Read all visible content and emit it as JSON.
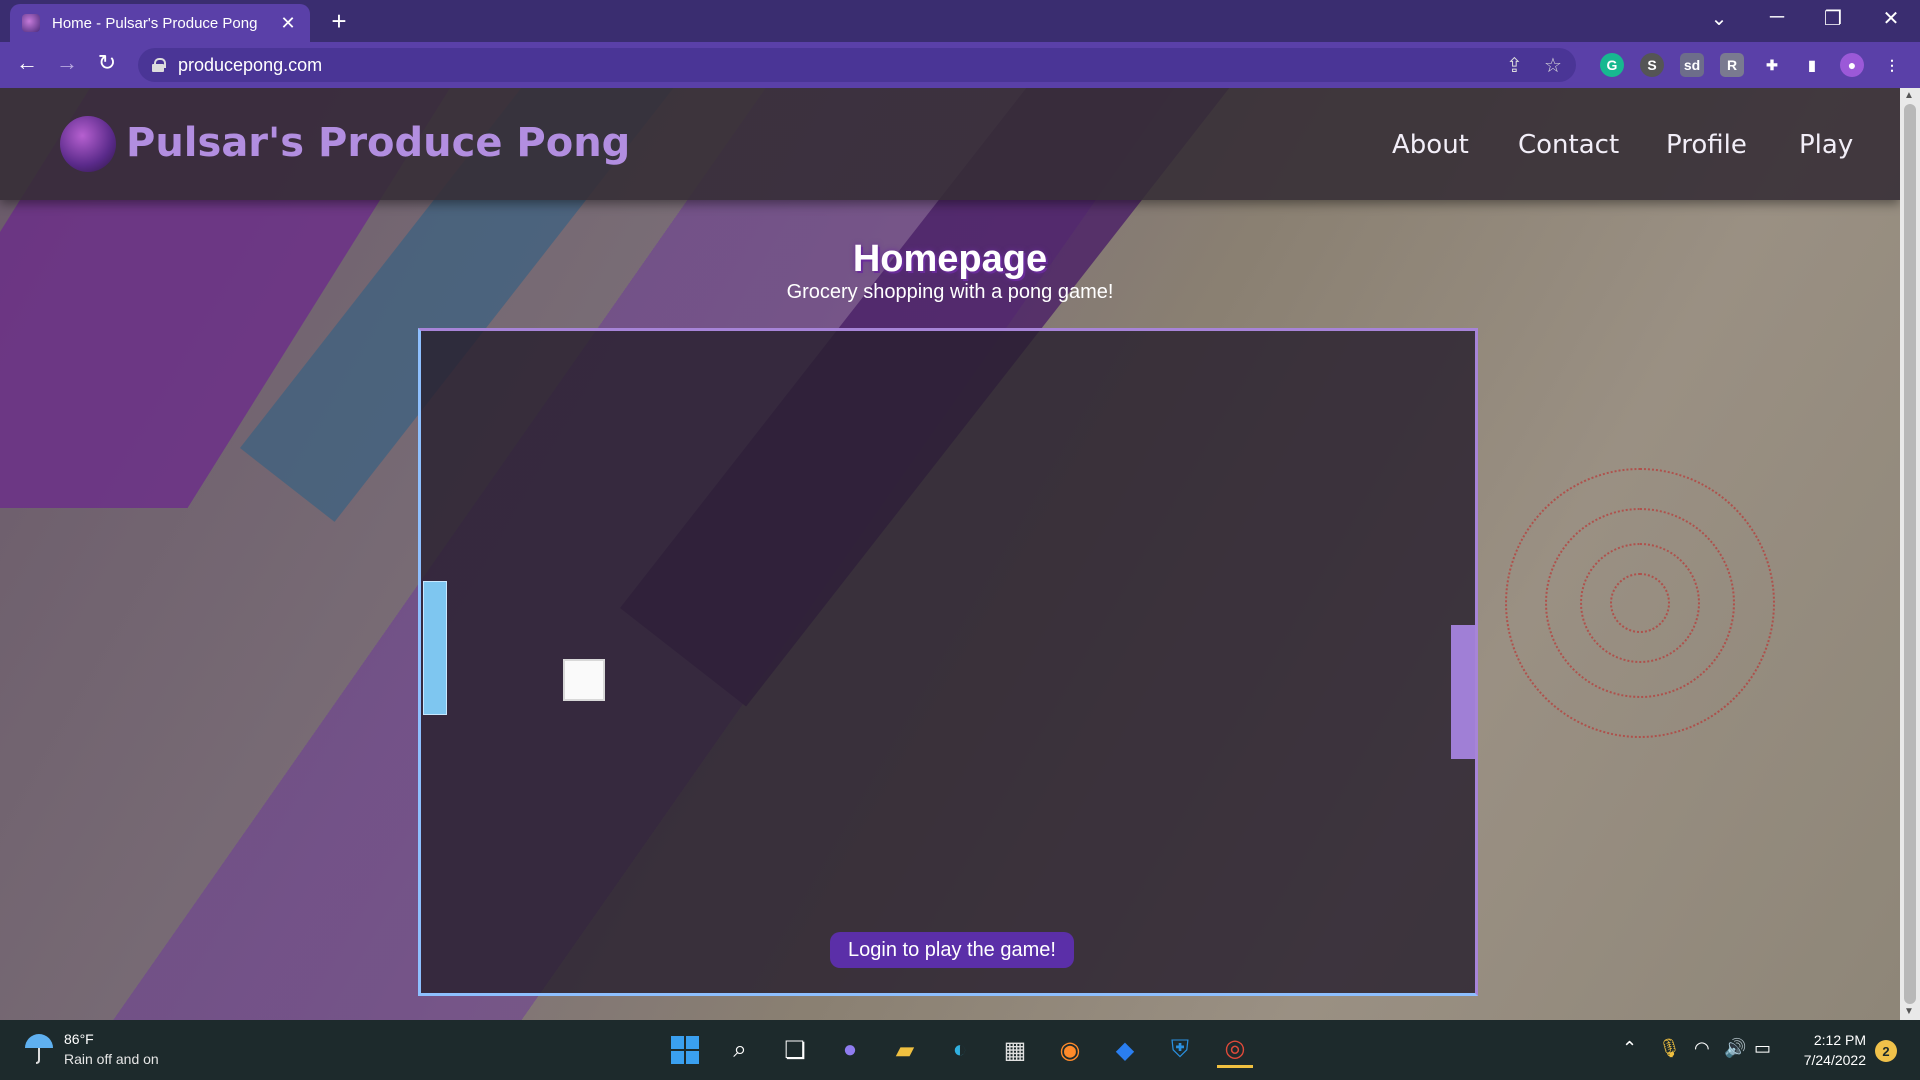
{
  "browser": {
    "tab_title": "Home - Pulsar's Produce Pong",
    "tab_close": "✕",
    "new_tab": "+",
    "url": "producepong.com",
    "window_controls": [
      "chevron-down-icon",
      "minimize-icon",
      "restore-icon",
      "close-icon"
    ]
  },
  "site": {
    "title": "Pulsar's Produce Pong",
    "nav": [
      "About",
      "Contact",
      "Profile",
      "Play"
    ]
  },
  "page": {
    "heading": "Homepage",
    "subheading": "Grocery shopping with a pong game!",
    "login_button": "Login to play the game!"
  },
  "colors": {
    "tab_bar": "#3a2d70",
    "toolbar": "#5a40a8",
    "site_title": "#b28ee0",
    "left_paddle": "#7ec6f0",
    "right_paddle": "#a07fd6",
    "login_button": "#5b2fa8",
    "taskbar": "#1d2a2c"
  },
  "taskbar": {
    "weather_temp": "86°F",
    "weather_desc": "Rain off and on",
    "time": "2:12 PM",
    "date": "7/24/2022",
    "notification_count": "2"
  }
}
